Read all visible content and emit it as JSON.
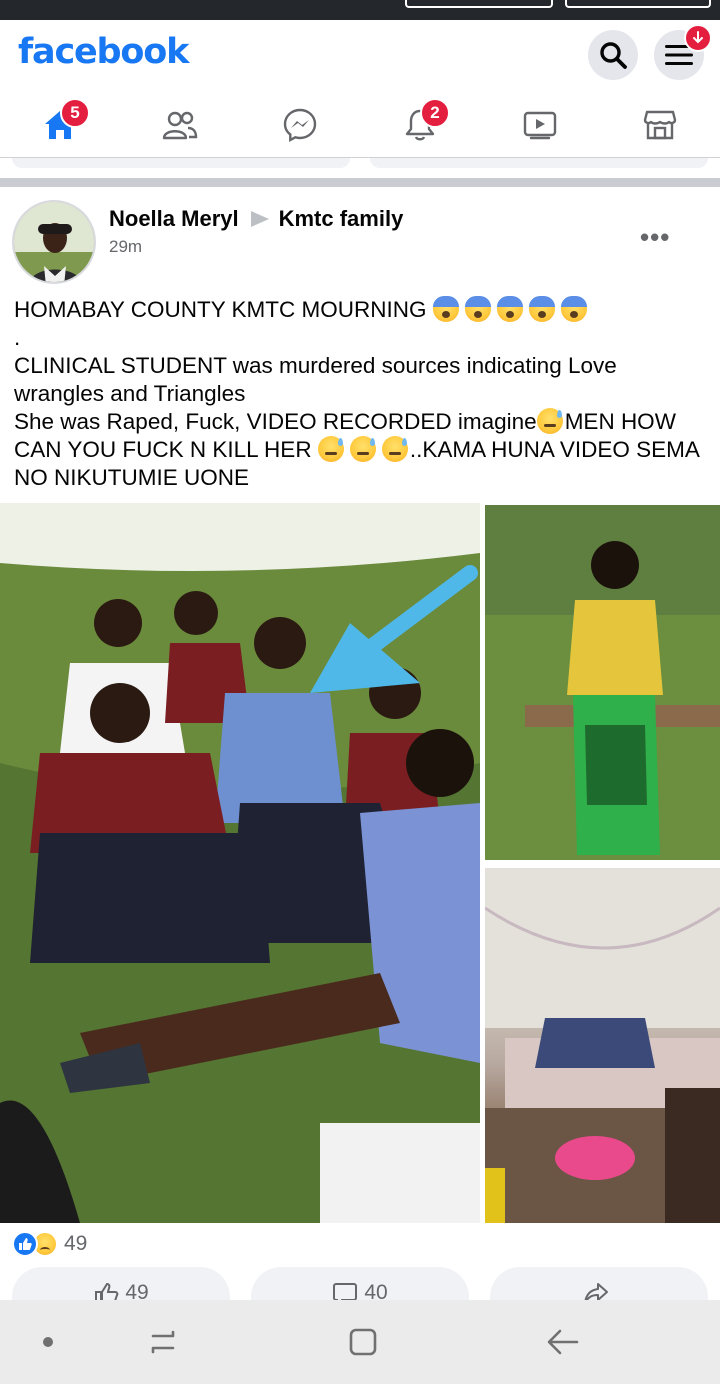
{
  "app": {
    "logo": "facebook",
    "brand_color": "#1877f2"
  },
  "header": {
    "search_icon": "search-icon",
    "menu_icon": "menu-icon",
    "menu_badge_icon": "download-arrow-icon"
  },
  "tabs": [
    {
      "name": "home",
      "icon": "home-icon",
      "badge": "5",
      "active": true
    },
    {
      "name": "friends",
      "icon": "friends-icon",
      "badge": ""
    },
    {
      "name": "messenger",
      "icon": "messenger-icon",
      "badge": ""
    },
    {
      "name": "notifications",
      "icon": "bell-icon",
      "badge": "2"
    },
    {
      "name": "watch",
      "icon": "video-icon",
      "badge": ""
    },
    {
      "name": "marketplace",
      "icon": "marketplace-icon",
      "badge": ""
    }
  ],
  "post": {
    "author": "Noella Meryl",
    "group": "Kmtc family",
    "time": "29m",
    "line1": "HOMABAY COUNTY KMTC MOURNING",
    "line2": ".",
    "line3": "CLINICAL STUDENT was murdered sources indicating Love wrangles and Triangles",
    "line4a": "She was Raped, Fuck, VIDEO RECORDED imagine",
    "line4b": "MEN HOW CAN YOU FUCK N KILL HER ",
    "line4c": "..KAMA HUNA VIDEO SEMA NO NIKUTUMIE UONE",
    "reaction_count": "49",
    "like_count": "49",
    "comment_count": "40"
  }
}
